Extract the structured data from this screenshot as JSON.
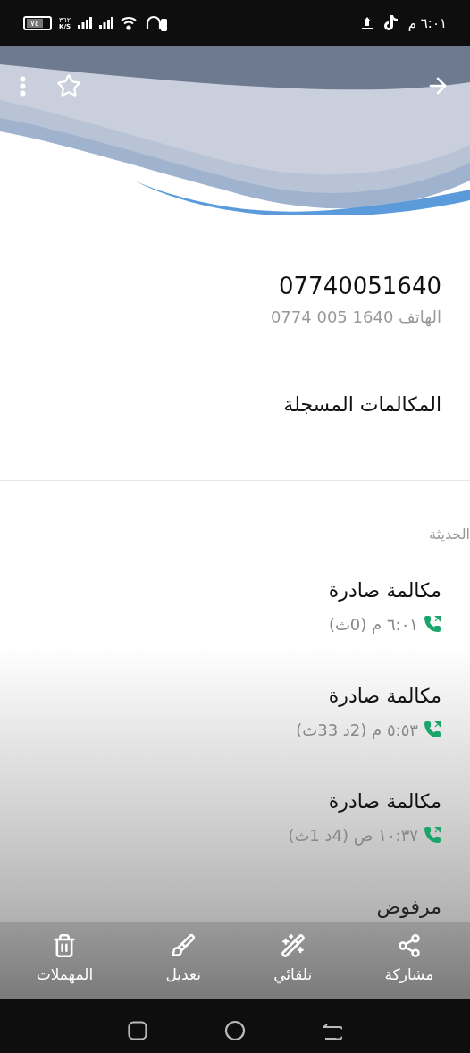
{
  "status_bar": {
    "time": "٦:٠١ م",
    "battery": "٧٤",
    "speed_value": "٣٦٢",
    "speed_unit": "K/S"
  },
  "contact": {
    "number": "07740051640",
    "phone_label": "الهاتف",
    "phone_formatted": "0774 005 1640",
    "favorite": false
  },
  "section_title": "المكالمات المسجلة",
  "group_label": "الحديثة",
  "calls": [
    {
      "title": "مكالمة صادرة",
      "detail": "٦:٠١ م (0ث)",
      "kind": "outgoing"
    },
    {
      "title": "مكالمة صادرة",
      "detail": "٥:٥٣ م (2د 33ث)",
      "kind": "outgoing"
    },
    {
      "title": "مكالمة صادرة",
      "detail": "١٠:٣٧ ص (4د 1ث)",
      "kind": "outgoing"
    }
  ],
  "partial_call_title": "مرفوض",
  "toolbar": [
    {
      "label": "مشاركة",
      "kind": "share"
    },
    {
      "label": "تلقائي",
      "kind": "auto"
    },
    {
      "label": "تعديل",
      "kind": "edit"
    },
    {
      "label": "المهملات",
      "kind": "trash"
    }
  ]
}
